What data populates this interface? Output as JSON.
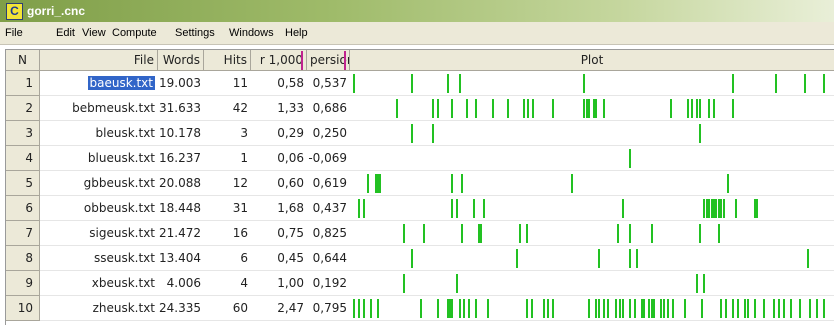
{
  "window": {
    "title": "gorri_.cnc",
    "icon": "C"
  },
  "menu": [
    "File",
    "Edit",
    "View",
    "Compute",
    "Settings",
    "Windows",
    "Help"
  ],
  "columns": [
    "N",
    "File",
    "Words",
    "Hits",
    "r 1,000",
    "persion",
    "Plot"
  ],
  "rows": [
    {
      "n": "1",
      "file": "baeusk.txt",
      "words": "19.003",
      "hits": "11",
      "r1000": "0,58",
      "persion": "0,537",
      "plot": [
        0.0,
        0.12,
        0.195,
        0.22,
        0.48,
        0.79,
        0.88,
        0.94,
        0.98
      ]
    },
    {
      "n": "2",
      "file": "bebmeusk.txt",
      "words": "31.633",
      "hits": "42",
      "r1000": "1,33",
      "persion": "0,686",
      "plot": [
        0.09,
        0.165,
        0.175,
        0.205,
        0.235,
        0.255,
        0.29,
        0.32,
        0.355,
        0.362,
        0.372,
        0.415,
        0.48,
        0.485,
        0.49,
        0.5,
        0.505,
        0.52,
        0.66,
        0.695,
        0.705,
        0.715,
        0.72,
        0.74,
        0.75,
        0.79
      ]
    },
    {
      "n": "3",
      "file": "bleusk.txt",
      "words": "10.178",
      "hits": "3",
      "r1000": "0,29",
      "persion": "0,250",
      "plot": [
        0.12,
        0.165,
        0.72
      ]
    },
    {
      "n": "4",
      "file": "blueusk.txt",
      "words": "16.237",
      "hits": "1",
      "r1000": "0,06",
      "persion": "-0,069",
      "plot": [
        0.575
      ]
    },
    {
      "n": "5",
      "file": "gbbeusk.txt",
      "words": "20.088",
      "hits": "12",
      "r1000": "0,60",
      "persion": "0,619",
      "plot": [
        0.03,
        0.045,
        0.05,
        0.055,
        0.205,
        0.225,
        0.455,
        0.78
      ]
    },
    {
      "n": "6",
      "file": "obbeusk.txt",
      "words": "18.448",
      "hits": "31",
      "r1000": "1,68",
      "persion": "0,437",
      "plot": [
        0.01,
        0.02,
        0.205,
        0.215,
        0.25,
        0.27,
        0.56,
        0.73,
        0.735,
        0.74,
        0.745,
        0.75,
        0.755,
        0.76,
        0.765,
        0.77,
        0.795,
        0.835,
        0.84
      ]
    },
    {
      "n": "7",
      "file": "sigeusk.txt",
      "words": "21.472",
      "hits": "16",
      "r1000": "0,75",
      "persion": "0,825",
      "plot": [
        0.105,
        0.145,
        0.225,
        0.26,
        0.265,
        0.345,
        0.36,
        0.55,
        0.575,
        0.62,
        0.72,
        0.76
      ]
    },
    {
      "n": "8",
      "file": "sseusk.txt",
      "words": "13.404",
      "hits": "6",
      "r1000": "0,45",
      "persion": "0,644",
      "plot": [
        0.12,
        0.34,
        0.51,
        0.575,
        0.59,
        0.945
      ]
    },
    {
      "n": "9",
      "file": "xbeusk.txt",
      "words": "4.006",
      "hits": "4",
      "r1000": "1,00",
      "persion": "0,192",
      "plot": [
        0.105,
        0.215,
        0.715,
        0.73
      ]
    },
    {
      "n": "10",
      "file": "zheusk.txt",
      "words": "24.335",
      "hits": "60",
      "r1000": "2,47",
      "persion": "0,795",
      "plot": [
        0.0,
        0.01,
        0.02,
        0.035,
        0.05,
        0.14,
        0.175,
        0.195,
        0.2,
        0.205,
        0.22,
        0.23,
        0.24,
        0.255,
        0.28,
        0.36,
        0.37,
        0.395,
        0.405,
        0.415,
        0.49,
        0.505,
        0.51,
        0.52,
        0.53,
        0.545,
        0.555,
        0.56,
        0.575,
        0.585,
        0.6,
        0.605,
        0.615,
        0.62,
        0.625,
        0.64,
        0.645,
        0.655,
        0.665,
        0.69,
        0.725,
        0.765,
        0.775,
        0.79,
        0.8,
        0.815,
        0.82,
        0.835,
        0.855,
        0.875,
        0.885,
        0.895,
        0.91,
        0.93,
        0.95,
        0.965,
        0.98
      ]
    }
  ],
  "selected_row": 0,
  "colors": {
    "plot_mark": "#22c122",
    "selection": "#3165c8",
    "sort_marker": "#c0238f"
  }
}
